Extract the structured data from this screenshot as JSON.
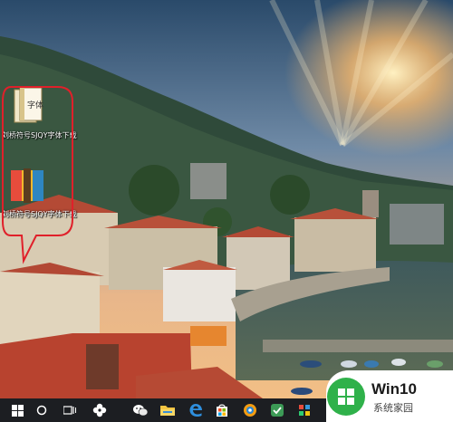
{
  "desktop": {
    "icons": [
      {
        "label": "刘桥符号SJQY字体下载",
        "icon": "book-icon"
      },
      {
        "label": "刘桥符号SJQY字体下载",
        "icon": "installer-box-icon"
      }
    ]
  },
  "taskbar": {
    "buttons": [
      {
        "name": "start-button",
        "icon": "windows-icon"
      },
      {
        "name": "search-button",
        "icon": "circle-icon"
      },
      {
        "name": "task-view-button",
        "icon": "task-view-icon"
      },
      {
        "name": "pinwheel-app-button",
        "icon": "pinwheel-icon"
      },
      {
        "name": "wechat-button",
        "icon": "wechat-icon"
      },
      {
        "name": "file-explorer-button",
        "icon": "folder-icon"
      },
      {
        "name": "edge-button",
        "icon": "edge-icon"
      },
      {
        "name": "store-button",
        "icon": "store-icon"
      },
      {
        "name": "browser-button",
        "icon": "browser-icon"
      },
      {
        "name": "app-button",
        "icon": "app-icon"
      }
    ]
  },
  "watermark": {
    "title": "Win10",
    "subtitle": "系统家园"
  },
  "colors": {
    "annotation": "#e0202a",
    "taskbar": "#1c1e22",
    "watermark_green": "#2fb14a"
  }
}
